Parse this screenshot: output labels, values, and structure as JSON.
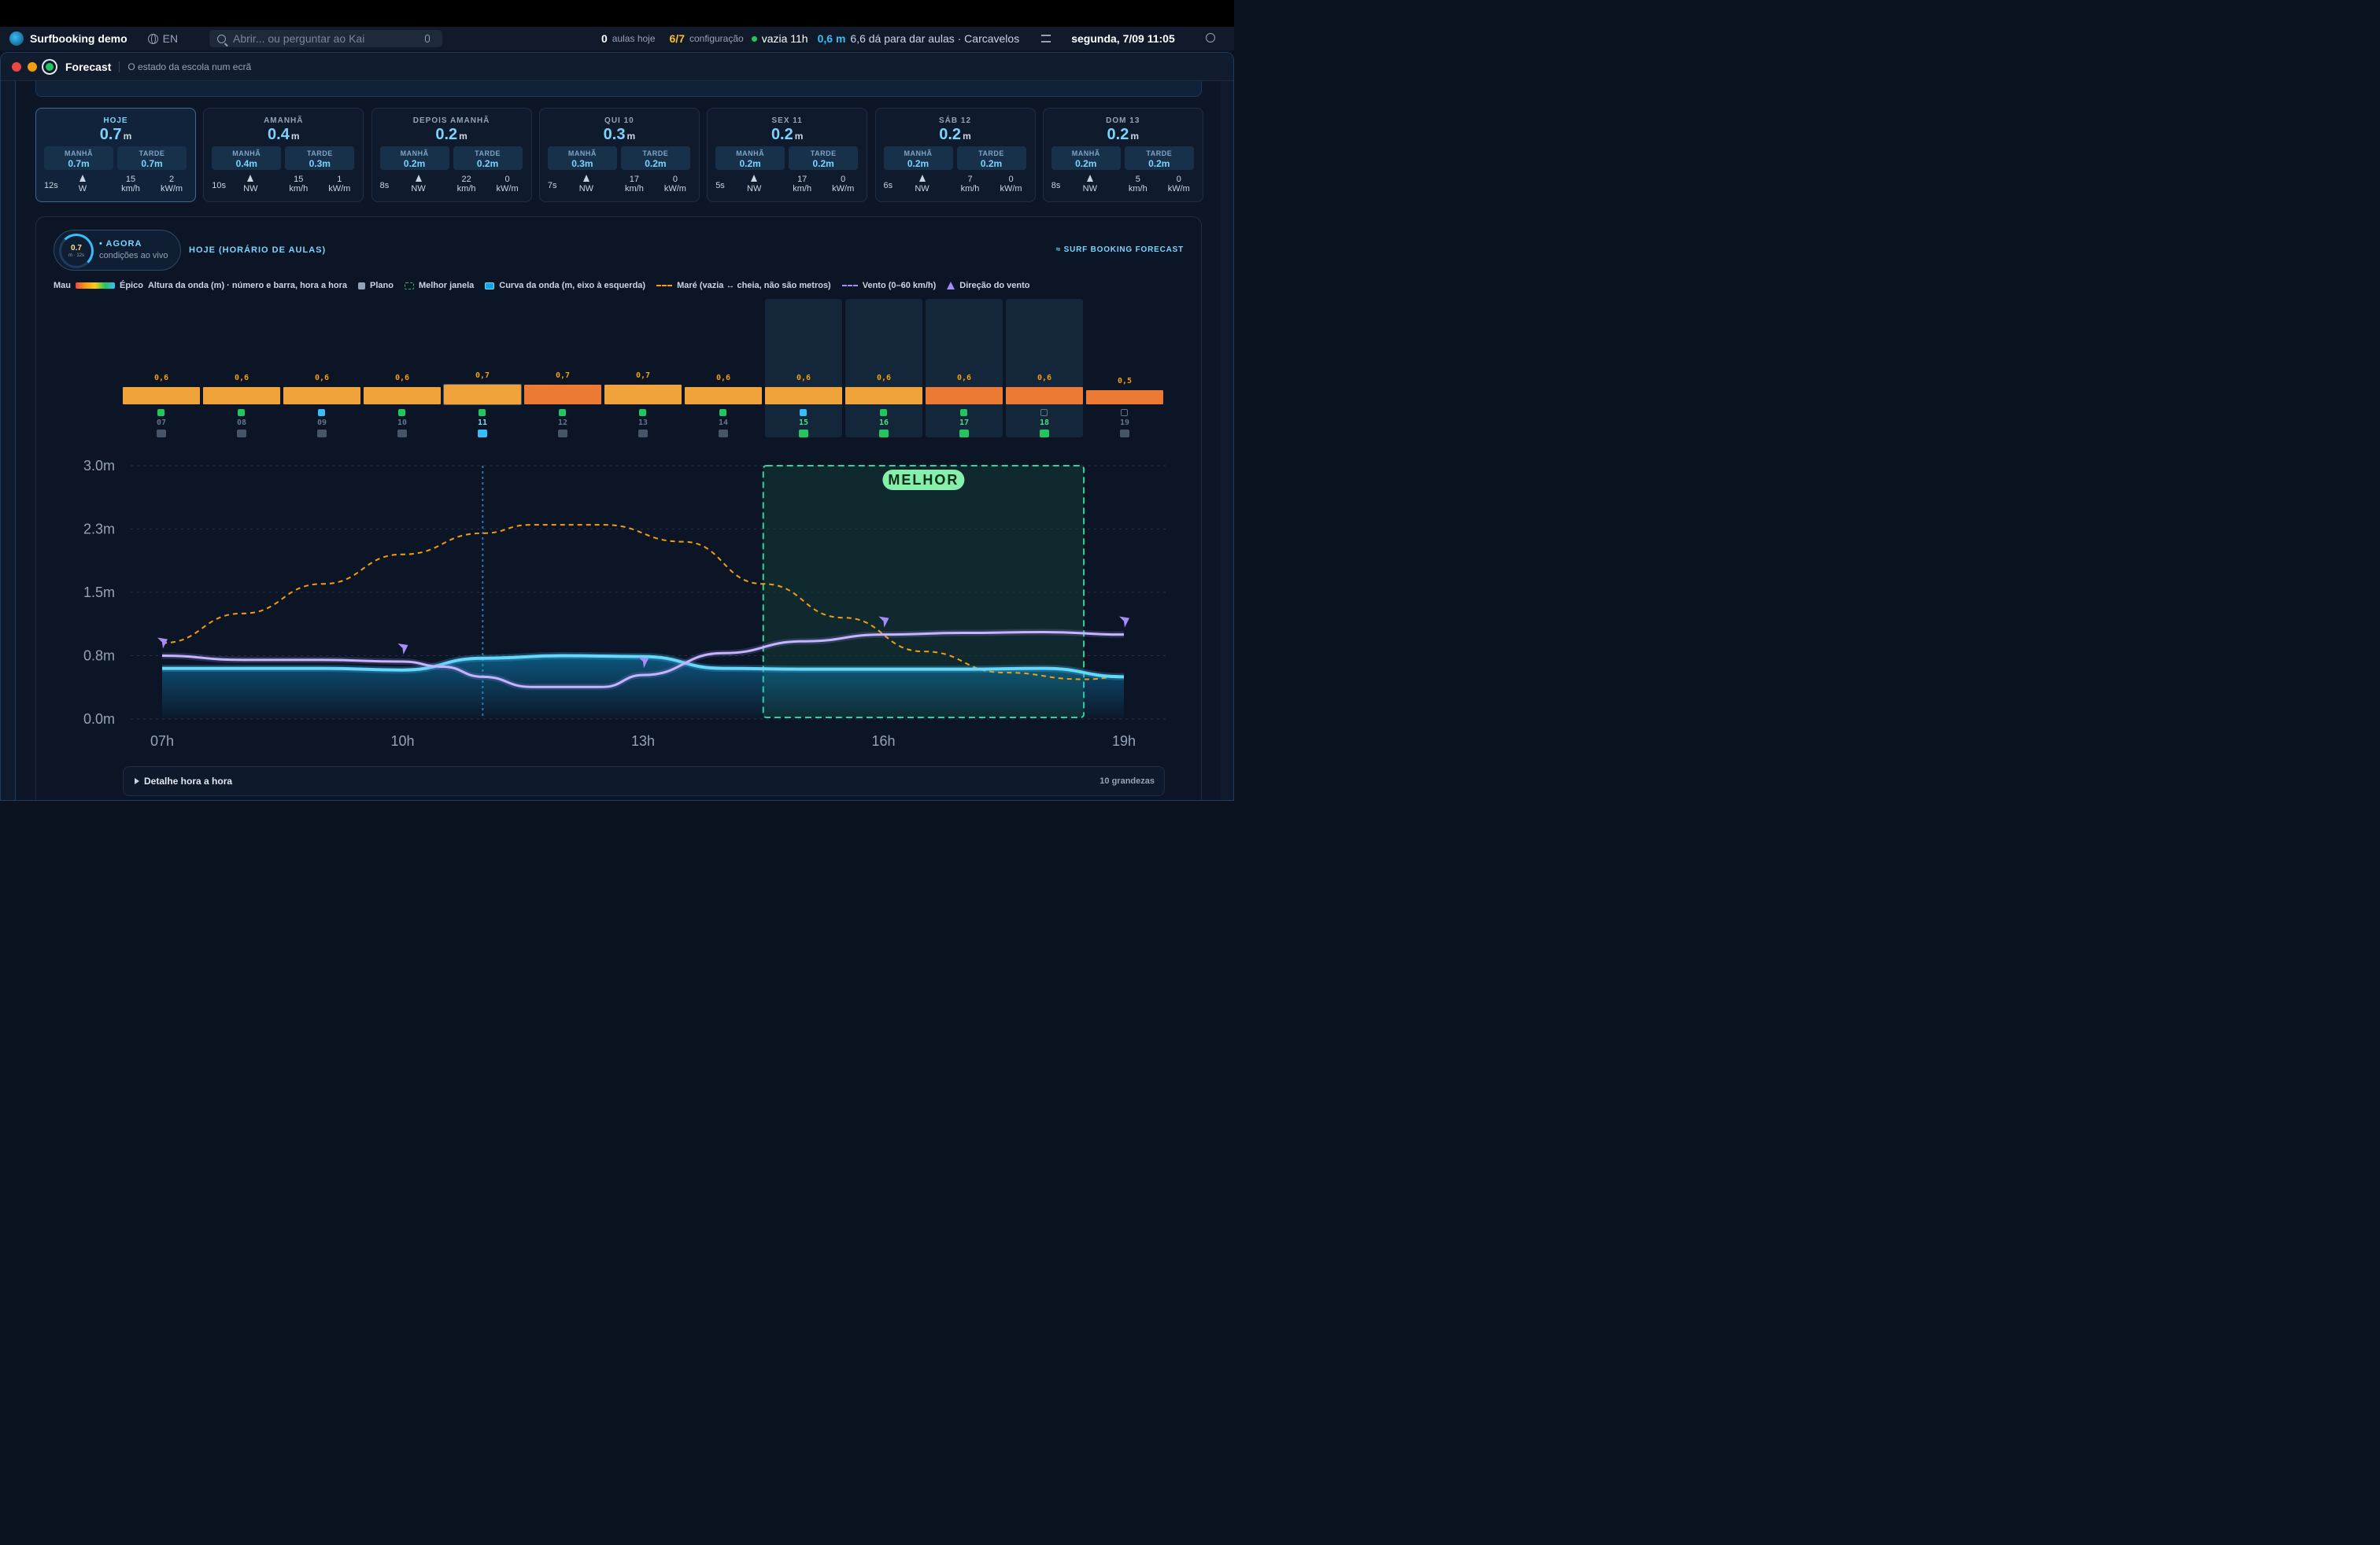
{
  "menubar": {
    "app_name": "Surfbooking demo",
    "lang": "EN",
    "search_placeholder": "Abrir... ou perguntar ao Kai",
    "classes_count": "0",
    "classes_label": "aulas hoje",
    "config_value": "6/7",
    "config_label": "configuração",
    "tide_label": "vazia 11h",
    "wave_value": "0,6 m",
    "location": "6,6 dá para dar aulas · Carcavelos",
    "datetime": "segunda, 7/09 11:05"
  },
  "window": {
    "title": "Forecast",
    "subtitle": "O estado da escola num ecrã"
  },
  "days": [
    {
      "name": "HOJE",
      "value": "0.7",
      "morning": "0.7m",
      "afternoon": "0.7m",
      "period": "12s",
      "dir": "W",
      "wind": "15",
      "power": "2"
    },
    {
      "name": "AMANHÃ",
      "value": "0.4",
      "morning": "0.4m",
      "afternoon": "0.3m",
      "period": "10s",
      "dir": "NW",
      "wind": "15",
      "power": "1"
    },
    {
      "name": "DEPOIS AMANHÃ",
      "value": "0.2",
      "morning": "0.2m",
      "afternoon": "0.2m",
      "period": "8s",
      "dir": "NW",
      "wind": "22",
      "power": "0"
    },
    {
      "name": "QUI 10",
      "value": "0.3",
      "morning": "0.3m",
      "afternoon": "0.2m",
      "period": "7s",
      "dir": "NW",
      "wind": "17",
      "power": "0"
    },
    {
      "name": "SEX 11",
      "value": "0.2",
      "morning": "0.2m",
      "afternoon": "0.2m",
      "period": "5s",
      "dir": "NW",
      "wind": "17",
      "power": "0"
    },
    {
      "name": "SÁB 12",
      "value": "0.2",
      "morning": "0.2m",
      "afternoon": "0.2m",
      "period": "6s",
      "dir": "NW",
      "wind": "7",
      "power": "0"
    },
    {
      "name": "DOM 13",
      "value": "0.2",
      "morning": "0.2m",
      "afternoon": "0.2m",
      "period": "8s",
      "dir": "NW",
      "wind": "5",
      "power": "0"
    }
  ],
  "labels": {
    "unit_m": "m",
    "morning": "MANHÃ",
    "afternoon": "TARDE",
    "kmh": "km/h",
    "kwm": "kW/m"
  },
  "now": {
    "ring_value": "0.7",
    "ring_sub": "m · 12s",
    "title": "• AGORA",
    "subtitle": "condições ao vivo"
  },
  "schedule_title": "HOJE (HORÁRIO DE AULAS)",
  "brand": "≈ SURF BOOKING FORECAST",
  "legend": {
    "bad": "Mau",
    "epic": "Épico",
    "wave_height": "Altura da onda (m) · número e barra, hora a hora",
    "flat": "Plano",
    "best_window": "Melhor janela",
    "wave_curve": "Curva da onda (m, eixo à esquerda)",
    "tide": "Maré (vazia ↔ cheia, não são metros)",
    "wind": "Vento (0–60 km/h)",
    "wind_dir": "Direção do vento"
  },
  "hours": [
    {
      "hour": "07",
      "value": "0,6",
      "level": 0.6,
      "color": "#f0a33a",
      "status": "#22c55e"
    },
    {
      "hour": "08",
      "value": "0,6",
      "level": 0.6,
      "color": "#f0a33a",
      "status": "#22c55e"
    },
    {
      "hour": "09",
      "value": "0,6",
      "level": 0.6,
      "color": "#f0a33a",
      "status": "#38bdf8"
    },
    {
      "hour": "10",
      "value": "0,6",
      "level": 0.6,
      "color": "#f0a33a",
      "status": "#22c55e"
    },
    {
      "hour": "11",
      "value": "0,7",
      "level": 0.7,
      "color": "#f0a33a",
      "status": "#22c55e"
    },
    {
      "hour": "12",
      "value": "0,7",
      "level": 0.7,
      "color": "#ec7a35",
      "status": "#22c55e"
    },
    {
      "hour": "13",
      "value": "0,7",
      "level": 0.7,
      "color": "#f0a33a",
      "status": "#22c55e"
    },
    {
      "hour": "14",
      "value": "0,6",
      "level": 0.6,
      "color": "#f0a33a",
      "status": "#22c55e"
    },
    {
      "hour": "15",
      "value": "0,6",
      "level": 0.6,
      "color": "#f0a33a",
      "status": "#38bdf8"
    },
    {
      "hour": "16",
      "value": "0,6",
      "level": 0.6,
      "color": "#f0a33a",
      "status": "#22c55e"
    },
    {
      "hour": "17",
      "value": "0,6",
      "level": 0.6,
      "color": "#ec7a35",
      "status": "#22c55e"
    },
    {
      "hour": "18",
      "value": "0,6",
      "level": 0.6,
      "color": "#ec7a35",
      "status": "none"
    },
    {
      "hour": "19",
      "value": "0,5",
      "level": 0.5,
      "color": "#ec7a35",
      "status": "none"
    }
  ],
  "chart_data": {
    "type": "area",
    "x_ticks": [
      "07h",
      "10h",
      "13h",
      "16h",
      "19h"
    ],
    "y_ticks": [
      "3.0m",
      "2.3m",
      "1.5m",
      "0.8m",
      "0.0m"
    ],
    "ylim": [
      0,
      3.0
    ],
    "xlim": [
      7,
      19
    ],
    "best_label": "MELHOR",
    "best_window": [
      14.5,
      18.5
    ],
    "now_hour": 11,
    "series": [
      {
        "key": "wave",
        "color": "#38bdf8",
        "x": [
          7,
          8,
          9,
          10,
          11,
          12,
          13,
          14,
          15,
          16,
          17,
          18,
          19
        ],
        "y": [
          0.6,
          0.6,
          0.6,
          0.58,
          0.72,
          0.75,
          0.74,
          0.6,
          0.59,
          0.59,
          0.59,
          0.6,
          0.5
        ]
      },
      {
        "key": "tide",
        "color": "#f59e0b",
        "x": [
          7,
          8,
          9,
          10,
          11,
          11.6,
          12.5,
          13.5,
          14.5,
          15.5,
          16.5,
          17.5,
          18.5,
          19
        ],
        "y": [
          0.9,
          1.25,
          1.6,
          1.95,
          2.2,
          2.3,
          2.3,
          2.1,
          1.6,
          1.2,
          0.8,
          0.55,
          0.47,
          0.5
        ]
      },
      {
        "key": "wind",
        "color": "#a78bfa",
        "x": [
          7,
          8,
          9,
          10,
          10.5,
          11,
          11.6,
          12.5,
          13,
          14,
          15,
          16,
          17,
          18,
          19
        ],
        "y": [
          0.75,
          0.7,
          0.7,
          0.68,
          0.62,
          0.5,
          0.38,
          0.38,
          0.52,
          0.78,
          0.92,
          1.0,
          1.02,
          1.03,
          1.0
        ]
      }
    ],
    "wind_arrows": [
      7,
      10,
      13,
      16,
      19
    ]
  },
  "detail": {
    "title": "Detalhe hora a hora",
    "right": "10 grandezas"
  }
}
